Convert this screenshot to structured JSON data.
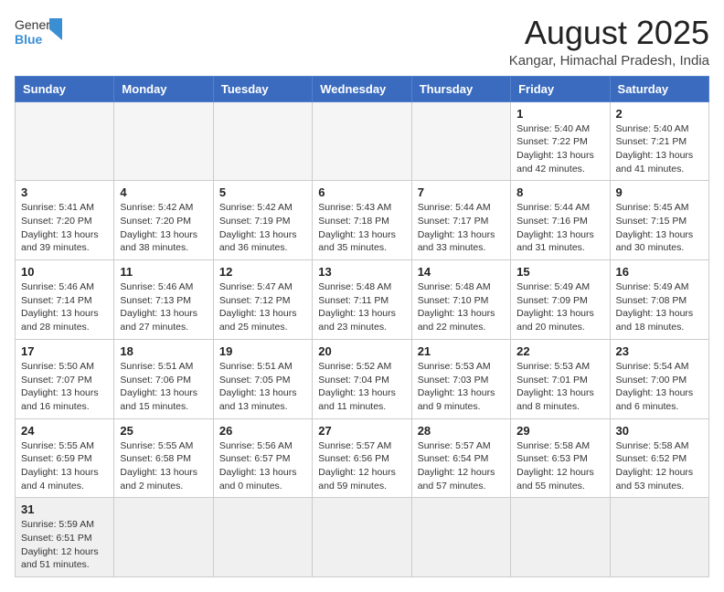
{
  "header": {
    "logo_general": "General",
    "logo_blue": "Blue",
    "title": "August 2025",
    "subtitle": "Kangar, Himachal Pradesh, India"
  },
  "weekdays": [
    "Sunday",
    "Monday",
    "Tuesday",
    "Wednesday",
    "Thursday",
    "Friday",
    "Saturday"
  ],
  "weeks": [
    [
      {
        "day": "",
        "info": ""
      },
      {
        "day": "",
        "info": ""
      },
      {
        "day": "",
        "info": ""
      },
      {
        "day": "",
        "info": ""
      },
      {
        "day": "",
        "info": ""
      },
      {
        "day": "1",
        "info": "Sunrise: 5:40 AM\nSunset: 7:22 PM\nDaylight: 13 hours\nand 42 minutes."
      },
      {
        "day": "2",
        "info": "Sunrise: 5:40 AM\nSunset: 7:21 PM\nDaylight: 13 hours\nand 41 minutes."
      }
    ],
    [
      {
        "day": "3",
        "info": "Sunrise: 5:41 AM\nSunset: 7:20 PM\nDaylight: 13 hours\nand 39 minutes."
      },
      {
        "day": "4",
        "info": "Sunrise: 5:42 AM\nSunset: 7:20 PM\nDaylight: 13 hours\nand 38 minutes."
      },
      {
        "day": "5",
        "info": "Sunrise: 5:42 AM\nSunset: 7:19 PM\nDaylight: 13 hours\nand 36 minutes."
      },
      {
        "day": "6",
        "info": "Sunrise: 5:43 AM\nSunset: 7:18 PM\nDaylight: 13 hours\nand 35 minutes."
      },
      {
        "day": "7",
        "info": "Sunrise: 5:44 AM\nSunset: 7:17 PM\nDaylight: 13 hours\nand 33 minutes."
      },
      {
        "day": "8",
        "info": "Sunrise: 5:44 AM\nSunset: 7:16 PM\nDaylight: 13 hours\nand 31 minutes."
      },
      {
        "day": "9",
        "info": "Sunrise: 5:45 AM\nSunset: 7:15 PM\nDaylight: 13 hours\nand 30 minutes."
      }
    ],
    [
      {
        "day": "10",
        "info": "Sunrise: 5:46 AM\nSunset: 7:14 PM\nDaylight: 13 hours\nand 28 minutes."
      },
      {
        "day": "11",
        "info": "Sunrise: 5:46 AM\nSunset: 7:13 PM\nDaylight: 13 hours\nand 27 minutes."
      },
      {
        "day": "12",
        "info": "Sunrise: 5:47 AM\nSunset: 7:12 PM\nDaylight: 13 hours\nand 25 minutes."
      },
      {
        "day": "13",
        "info": "Sunrise: 5:48 AM\nSunset: 7:11 PM\nDaylight: 13 hours\nand 23 minutes."
      },
      {
        "day": "14",
        "info": "Sunrise: 5:48 AM\nSunset: 7:10 PM\nDaylight: 13 hours\nand 22 minutes."
      },
      {
        "day": "15",
        "info": "Sunrise: 5:49 AM\nSunset: 7:09 PM\nDaylight: 13 hours\nand 20 minutes."
      },
      {
        "day": "16",
        "info": "Sunrise: 5:49 AM\nSunset: 7:08 PM\nDaylight: 13 hours\nand 18 minutes."
      }
    ],
    [
      {
        "day": "17",
        "info": "Sunrise: 5:50 AM\nSunset: 7:07 PM\nDaylight: 13 hours\nand 16 minutes."
      },
      {
        "day": "18",
        "info": "Sunrise: 5:51 AM\nSunset: 7:06 PM\nDaylight: 13 hours\nand 15 minutes."
      },
      {
        "day": "19",
        "info": "Sunrise: 5:51 AM\nSunset: 7:05 PM\nDaylight: 13 hours\nand 13 minutes."
      },
      {
        "day": "20",
        "info": "Sunrise: 5:52 AM\nSunset: 7:04 PM\nDaylight: 13 hours\nand 11 minutes."
      },
      {
        "day": "21",
        "info": "Sunrise: 5:53 AM\nSunset: 7:03 PM\nDaylight: 13 hours\nand 9 minutes."
      },
      {
        "day": "22",
        "info": "Sunrise: 5:53 AM\nSunset: 7:01 PM\nDaylight: 13 hours\nand 8 minutes."
      },
      {
        "day": "23",
        "info": "Sunrise: 5:54 AM\nSunset: 7:00 PM\nDaylight: 13 hours\nand 6 minutes."
      }
    ],
    [
      {
        "day": "24",
        "info": "Sunrise: 5:55 AM\nSunset: 6:59 PM\nDaylight: 13 hours\nand 4 minutes."
      },
      {
        "day": "25",
        "info": "Sunrise: 5:55 AM\nSunset: 6:58 PM\nDaylight: 13 hours\nand 2 minutes."
      },
      {
        "day": "26",
        "info": "Sunrise: 5:56 AM\nSunset: 6:57 PM\nDaylight: 13 hours\nand 0 minutes."
      },
      {
        "day": "27",
        "info": "Sunrise: 5:57 AM\nSunset: 6:56 PM\nDaylight: 12 hours\nand 59 minutes."
      },
      {
        "day": "28",
        "info": "Sunrise: 5:57 AM\nSunset: 6:54 PM\nDaylight: 12 hours\nand 57 minutes."
      },
      {
        "day": "29",
        "info": "Sunrise: 5:58 AM\nSunset: 6:53 PM\nDaylight: 12 hours\nand 55 minutes."
      },
      {
        "day": "30",
        "info": "Sunrise: 5:58 AM\nSunset: 6:52 PM\nDaylight: 12 hours\nand 53 minutes."
      }
    ],
    [
      {
        "day": "31",
        "info": "Sunrise: 5:59 AM\nSunset: 6:51 PM\nDaylight: 12 hours\nand 51 minutes."
      },
      {
        "day": "",
        "info": ""
      },
      {
        "day": "",
        "info": ""
      },
      {
        "day": "",
        "info": ""
      },
      {
        "day": "",
        "info": ""
      },
      {
        "day": "",
        "info": ""
      },
      {
        "day": "",
        "info": ""
      }
    ]
  ]
}
